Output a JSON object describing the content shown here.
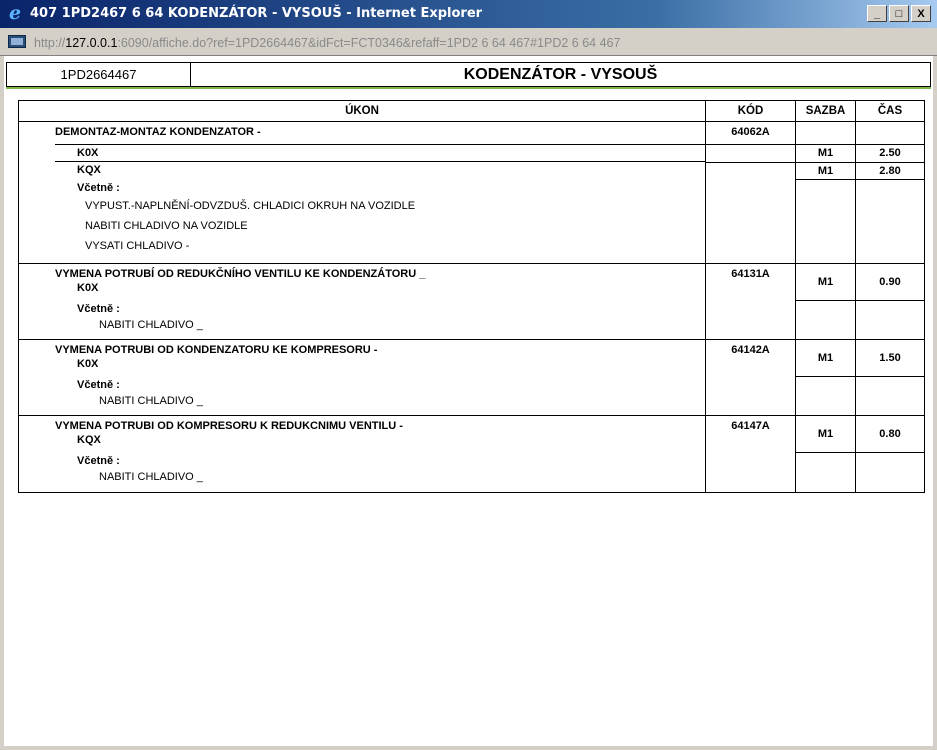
{
  "window": {
    "title": "407 1PD2467 6 64 KODENZÁTOR - VYSOUŠ - Internet Explorer",
    "url_scheme": "http://",
    "url_host": "127.0.0.1",
    "url_rest": ":6090/affiche.do?ref=1PD2664467&idFct=FCT0346&refaff=1PD2 6 64 467#1PD2 6 64 467",
    "minimize": "_",
    "maximize": "□",
    "close": "X"
  },
  "header": {
    "ref": "1PD2664467",
    "name": "KODENZÁTOR - VYSOUŠ"
  },
  "table": {
    "columns": {
      "ukon": "ÚKON",
      "kod": "KÓD",
      "sazba": "SAZBA",
      "cas": "ČAS"
    },
    "groups": [
      {
        "title": "DEMONTAZ-MONTAZ KONDENZATOR -",
        "kod": "64062A",
        "variants": [
          {
            "code": "K0X",
            "sazba": "M1",
            "cas": "2.50"
          },
          {
            "code": "KQX",
            "sazba": "M1",
            "cas": "2.80"
          }
        ],
        "vcetne_label": "Včetně :",
        "includes": [
          "VYPUST.-NAPLNĚNÍ-ODVZDUŠ. CHLADICI OKRUH NA VOZIDLE",
          "NABITI CHLADIVO NA VOZIDLE",
          "VYSATI CHLADIVO -"
        ]
      },
      {
        "title": "VYMENA POTRUBÍ OD REDUKČNÍHO VENTILU KE KONDENZÁTORU _",
        "variant": "K0X",
        "kod": "64131A",
        "sazba": "M1",
        "cas": "0.90",
        "vcetne_label": "Včetně :",
        "includes": [
          "NABITI CHLADIVO _"
        ]
      },
      {
        "title": "VYMENA POTRUBI OD KONDENZATORU KE KOMPRESORU -",
        "variant": "K0X",
        "kod": "64142A",
        "sazba": "M1",
        "cas": "1.50",
        "vcetne_label": "Včetně :",
        "includes": [
          "NABITI CHLADIVO _"
        ]
      },
      {
        "title": "VYMENA POTRUBI OD KOMPRESORU K REDUKCNIMU VENTILU -",
        "variant": "KQX",
        "kod": "64147A",
        "sazba": "M1",
        "cas": "0.80",
        "vcetne_label": "Včetně :",
        "includes": [
          "NABITI CHLADIVO _"
        ]
      }
    ]
  }
}
